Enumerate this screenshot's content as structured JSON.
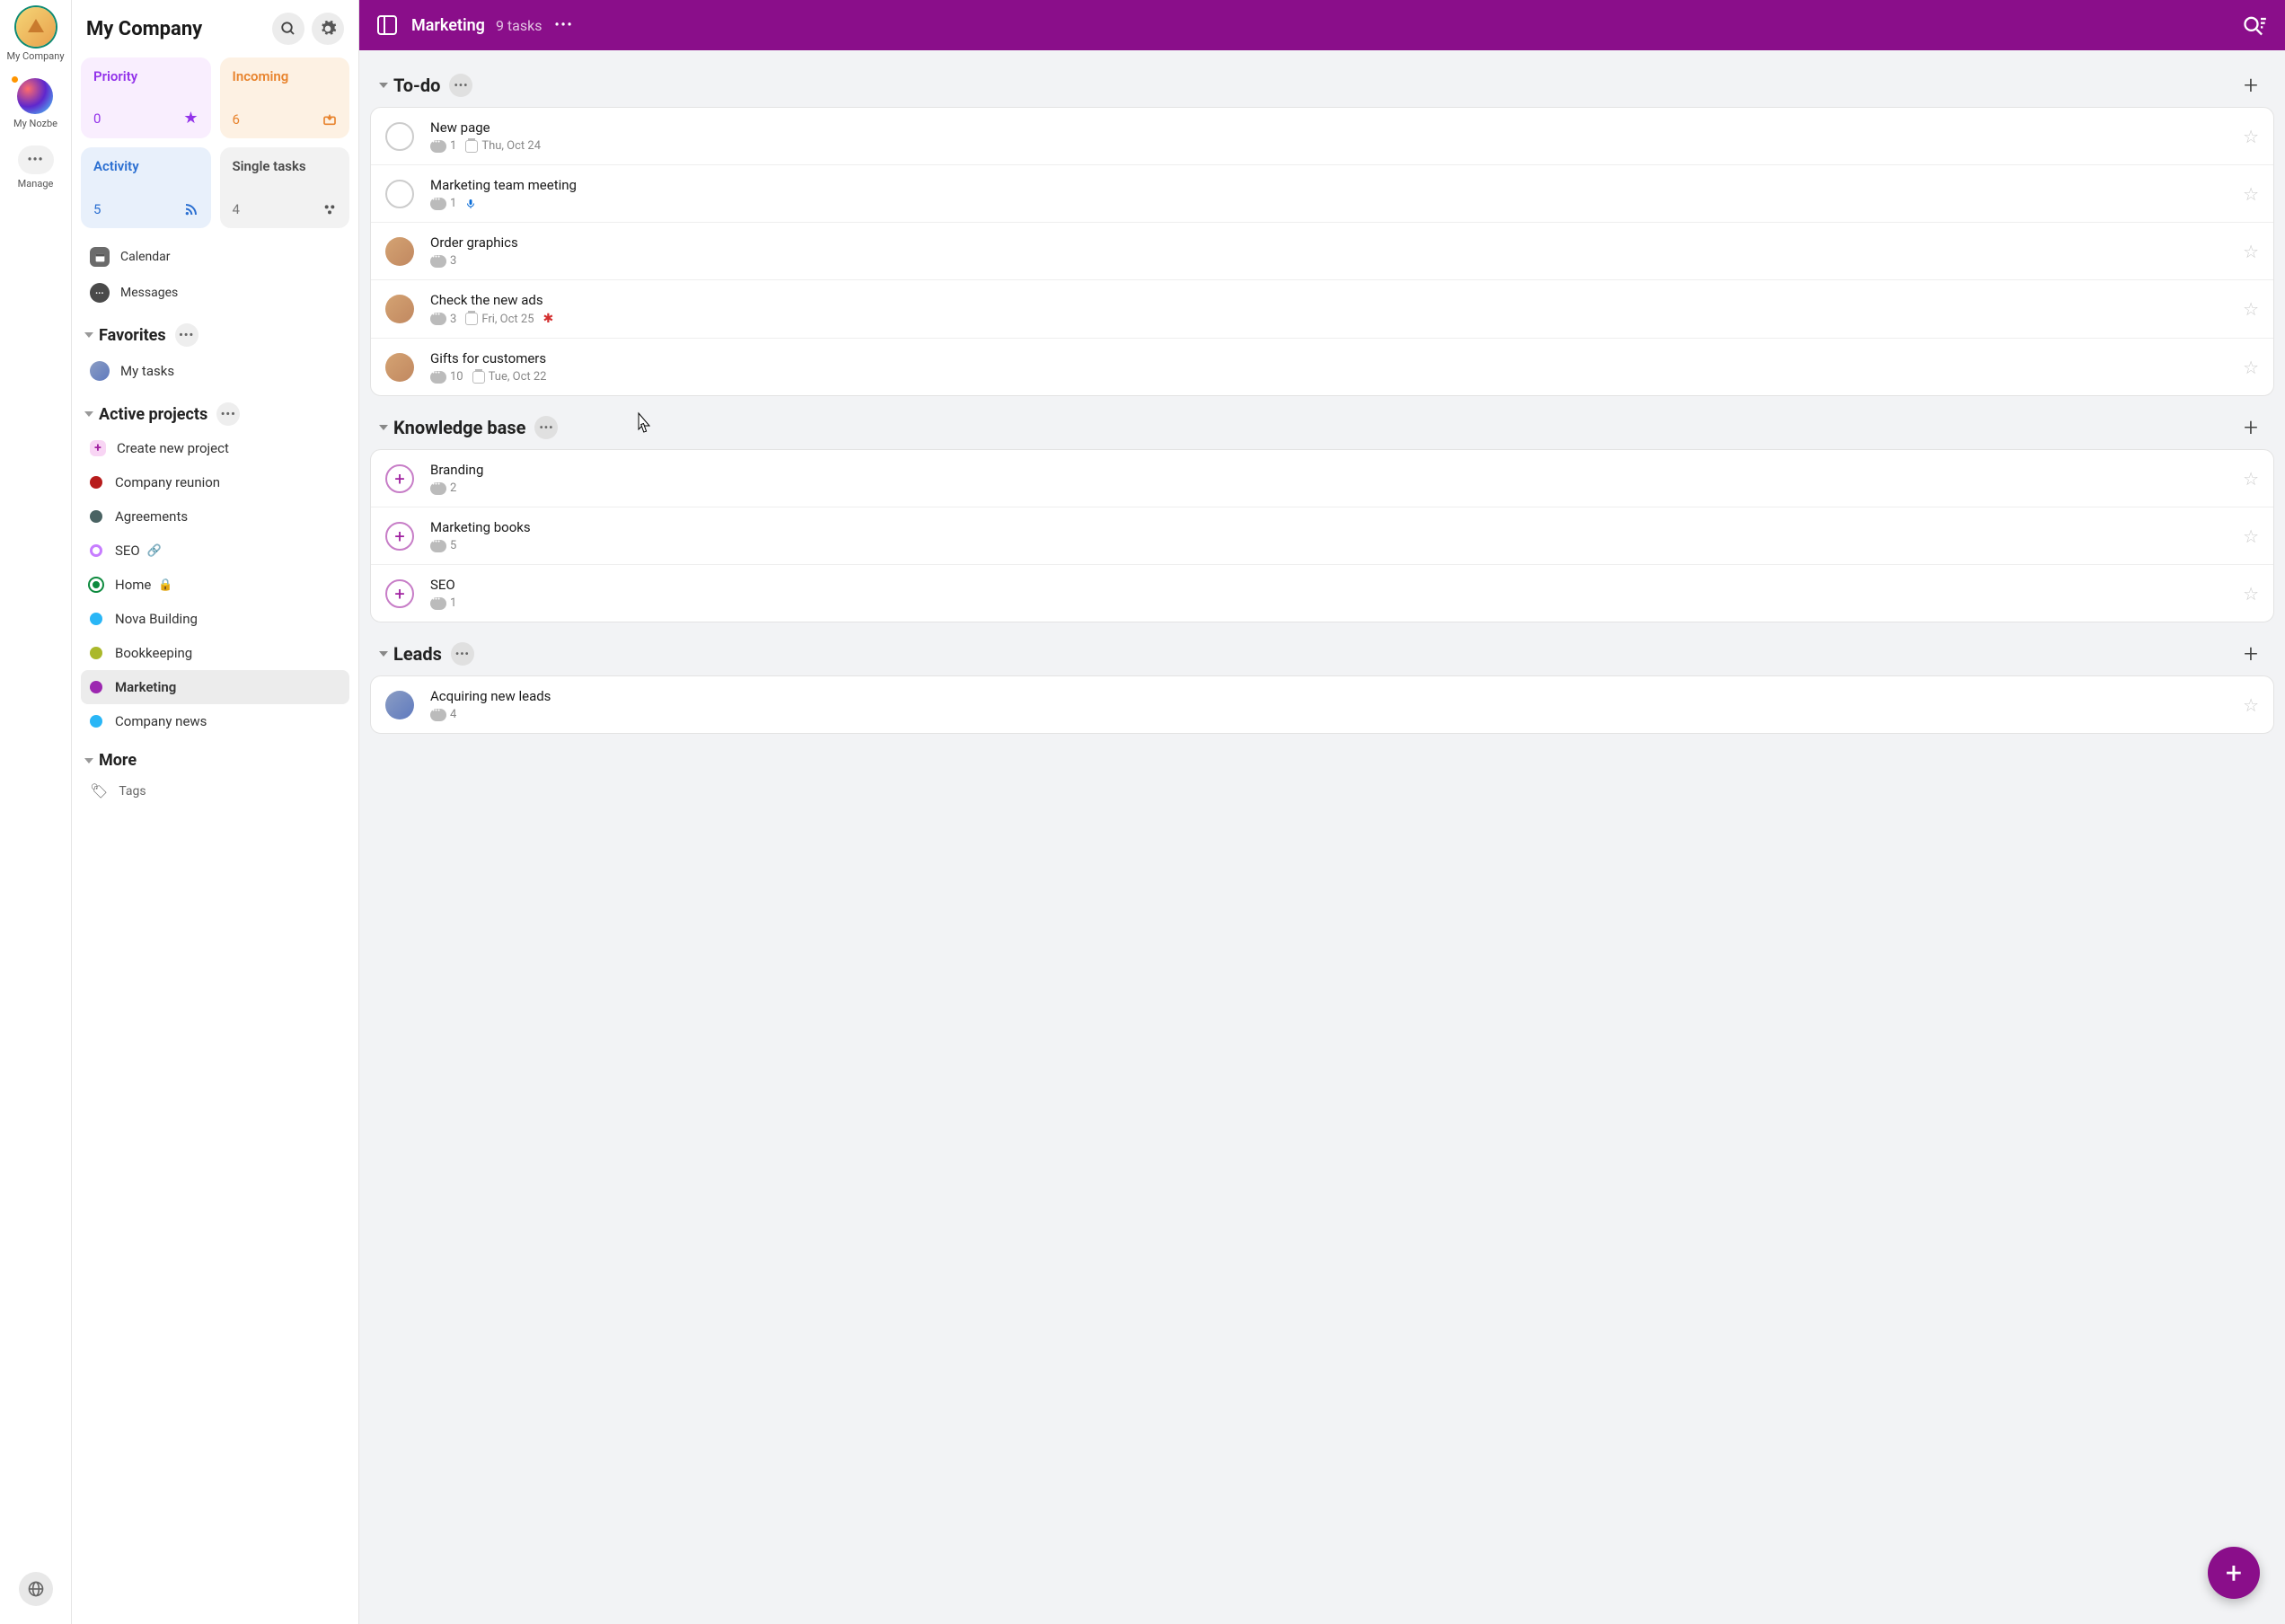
{
  "rail": {
    "workspace1": "My Company",
    "workspace2": "My Nozbe",
    "manage": "Manage"
  },
  "sidebar": {
    "title": "My Company",
    "cards": {
      "priority": {
        "title": "Priority",
        "count": "0"
      },
      "incoming": {
        "title": "Incoming",
        "count": "6"
      },
      "activity": {
        "title": "Activity",
        "count": "5"
      },
      "single": {
        "title": "Single tasks",
        "count": "4"
      }
    },
    "nav": {
      "calendar": "Calendar",
      "messages": "Messages"
    },
    "favorites_hdr": "Favorites",
    "favorites": {
      "mytasks": "My tasks"
    },
    "active_hdr": "Active projects",
    "create": "Create new project",
    "projects": [
      {
        "label": "Company reunion",
        "color": "#b71c1c"
      },
      {
        "label": "Agreements",
        "color": "#4a6363"
      },
      {
        "label": "SEO",
        "color": "#c77dff",
        "badge": "link"
      },
      {
        "label": "Home",
        "color": "#0d8a3e",
        "badge": "lock"
      },
      {
        "label": "Nova Building",
        "color": "#29b6f6"
      },
      {
        "label": "Bookkeeping",
        "color": "#aab82a"
      },
      {
        "label": "Marketing",
        "color": "#9c27b0",
        "active": true
      },
      {
        "label": "Company news",
        "color": "#29b6f6"
      }
    ],
    "more_hdr": "More",
    "tags": "Tags"
  },
  "topbar": {
    "title": "Marketing",
    "count": "9 tasks"
  },
  "groups": [
    {
      "title": "To-do",
      "tasks": [
        {
          "title": "New page",
          "comments": "1",
          "date": "Thu, Oct 24",
          "check": "empty"
        },
        {
          "title": "Marketing team meeting",
          "comments": "1",
          "mic": true,
          "check": "empty"
        },
        {
          "title": "Order graphics",
          "comments": "3",
          "check": "avatar"
        },
        {
          "title": "Check the new ads",
          "comments": "3",
          "date": "Fri, Oct 25",
          "flag": true,
          "check": "avatar"
        },
        {
          "title": "Gifts for customers",
          "comments": "10",
          "date": "Tue, Oct 22",
          "check": "avatar"
        }
      ]
    },
    {
      "title": "Knowledge base",
      "tasks": [
        {
          "title": "Branding",
          "comments": "2",
          "check": "plus"
        },
        {
          "title": "Marketing books",
          "comments": "5",
          "check": "plus"
        },
        {
          "title": "SEO",
          "comments": "1",
          "check": "plus"
        }
      ]
    },
    {
      "title": "Leads",
      "tasks": [
        {
          "title": "Acquiring new leads",
          "comments": "4",
          "check": "avatar-b"
        }
      ]
    }
  ]
}
